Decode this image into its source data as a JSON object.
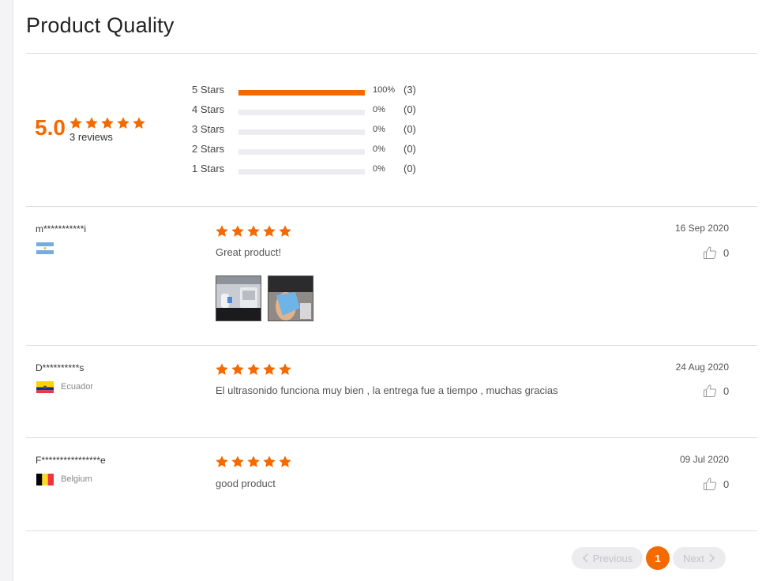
{
  "title": "Product Quality",
  "summary": {
    "score": "5.0",
    "stars": 5,
    "count_text": "3 reviews"
  },
  "distribution": [
    {
      "label": "5 Stars",
      "fraction": 1.0,
      "pct": "100%",
      "count": "(3)"
    },
    {
      "label": "4 Stars",
      "fraction": 0.0,
      "pct": "0%",
      "count": "(0)"
    },
    {
      "label": "3 Stars",
      "fraction": 0.0,
      "pct": "0%",
      "count": "(0)"
    },
    {
      "label": "2 Stars",
      "fraction": 0.0,
      "pct": "0%",
      "count": "(0)"
    },
    {
      "label": "1 Stars",
      "fraction": 0.0,
      "pct": "0%",
      "count": "(0)"
    }
  ],
  "reviews": [
    {
      "name": "m***********i",
      "country": "",
      "flag": "argentina-flag",
      "stars": 5,
      "text": "Great product!",
      "date": "16 Sep 2020",
      "likes": "0",
      "photos": [
        "ultrasound-device-photo",
        "ultrasound-probe-photo"
      ]
    },
    {
      "name": "D**********s",
      "country": "Ecuador",
      "flag": "ecuador-flag",
      "stars": 5,
      "text": "El ultrasonido funciona muy bien , la entrega fue a tiempo , muchas gracias",
      "date": "24 Aug 2020",
      "likes": "0",
      "photos": []
    },
    {
      "name": "F****************e",
      "country": "Belgium",
      "flag": "belgium-flag",
      "stars": 5,
      "text": "good product",
      "date": "09 Jul 2020",
      "likes": "0",
      "photos": []
    }
  ],
  "pagination": {
    "previous": "Previous",
    "current": "1",
    "next": "Next"
  },
  "colors": {
    "accent": "#f56a00",
    "track": "#ededf1"
  },
  "icons": {
    "star": "star-icon",
    "like": "thumbs-up-icon",
    "prev": "chevron-left-icon",
    "next": "chevron-right-icon"
  }
}
